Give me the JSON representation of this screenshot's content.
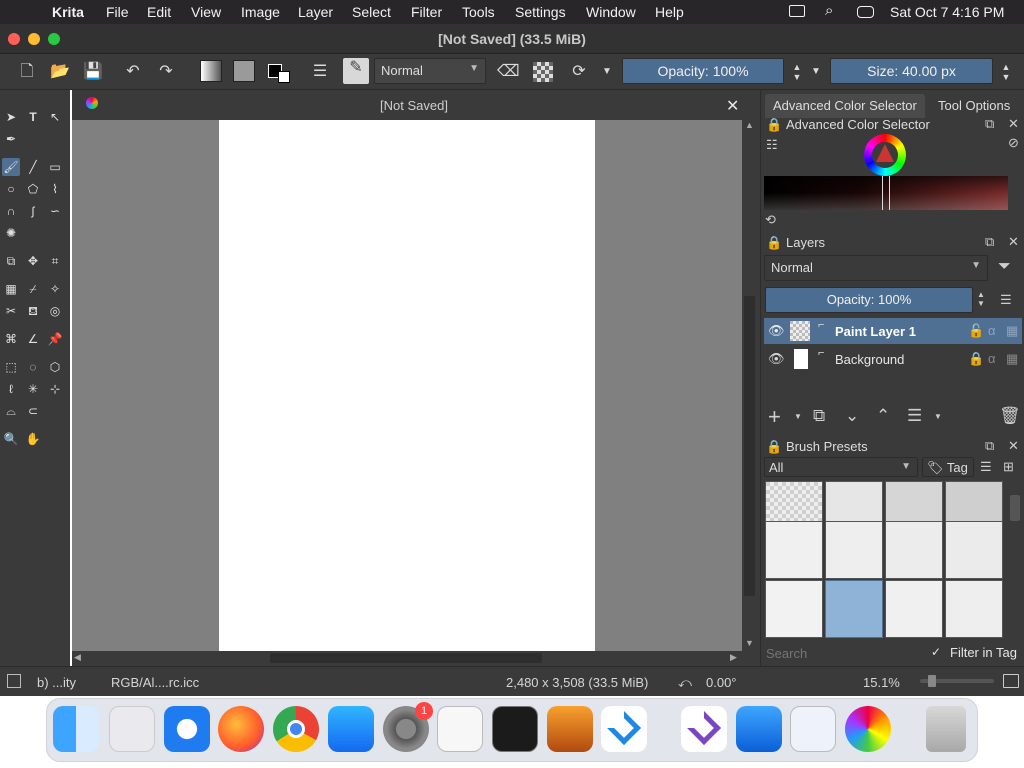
{
  "menubar": {
    "app": "Krita",
    "items": [
      "File",
      "Edit",
      "View",
      "Image",
      "Layer",
      "Select",
      "Filter",
      "Tools",
      "Settings",
      "Window",
      "Help"
    ],
    "clock": "Sat Oct 7  4:16 PM"
  },
  "window": {
    "title": "[Not Saved]  (33.5 MiB)",
    "traffic_colors": [
      "#ff5f57",
      "#febc2e",
      "#28c840"
    ]
  },
  "toolbar": {
    "blend_mode": "Normal",
    "opacity_label": "Opacity: 100%",
    "opacity_value": 1.0,
    "size_label": "Size: 40.00 px"
  },
  "document": {
    "tab_title": "[Not Saved]",
    "close_glyph": "✕"
  },
  "docker_tabs": [
    "Advanced Color Selector",
    "Tool Options"
  ],
  "color_selector": {
    "title": "Advanced Color Selector"
  },
  "layers": {
    "title": "Layers",
    "blend_mode": "Normal",
    "opacity_label": "Opacity:  100%",
    "items": [
      {
        "name": "Paint Layer 1",
        "selected": true
      },
      {
        "name": "Background",
        "selected": false
      }
    ]
  },
  "brush_presets": {
    "title": "Brush Presets",
    "filter": "All",
    "tag_label": "Tag",
    "search_placeholder": "Search",
    "filter_in_tag": "Filter in Tag",
    "filter_checked": true
  },
  "statusbar": {
    "tool_hint": "b) ...ity",
    "color_profile": "RGB/Al....rc.icc",
    "dimensions": "2,480 x 3,508 (33.5 MiB)",
    "rotation": "0.00°",
    "zoom": "15.1%"
  },
  "dock": {
    "badge_count": "1"
  },
  "colors": {
    "accent": "#4b6d91",
    "panel": "#3a3a3b",
    "menubar": "#29262a"
  }
}
